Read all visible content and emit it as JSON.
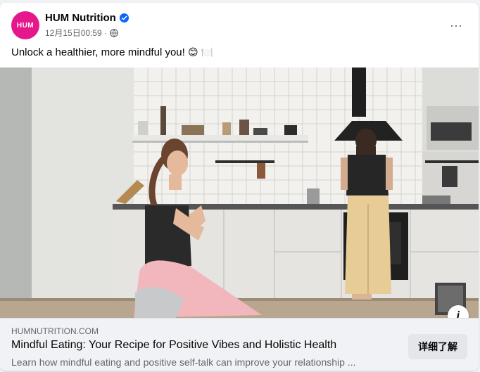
{
  "post": {
    "page_name": "HUM Nutrition",
    "avatar_text": "HUM",
    "timestamp": "12月15日00:59 ·",
    "caption": "Unlock a healthier, more mindful you!",
    "caption_emojis": "😊 🍽️",
    "more_icon": "···"
  },
  "photo": {
    "info_label": "i"
  },
  "link": {
    "domain": "HUMNUTRITION.COM",
    "title": "Mindful Eating: Your Recipe for Positive Vibes and Holistic Health",
    "description": "Learn how mindful eating and positive self-talk can improve your relationship ...",
    "cta_label": "详细了解"
  },
  "colors": {
    "brand": "#e6168c",
    "verified": "#0866ff",
    "secondary_text": "#65676b"
  }
}
